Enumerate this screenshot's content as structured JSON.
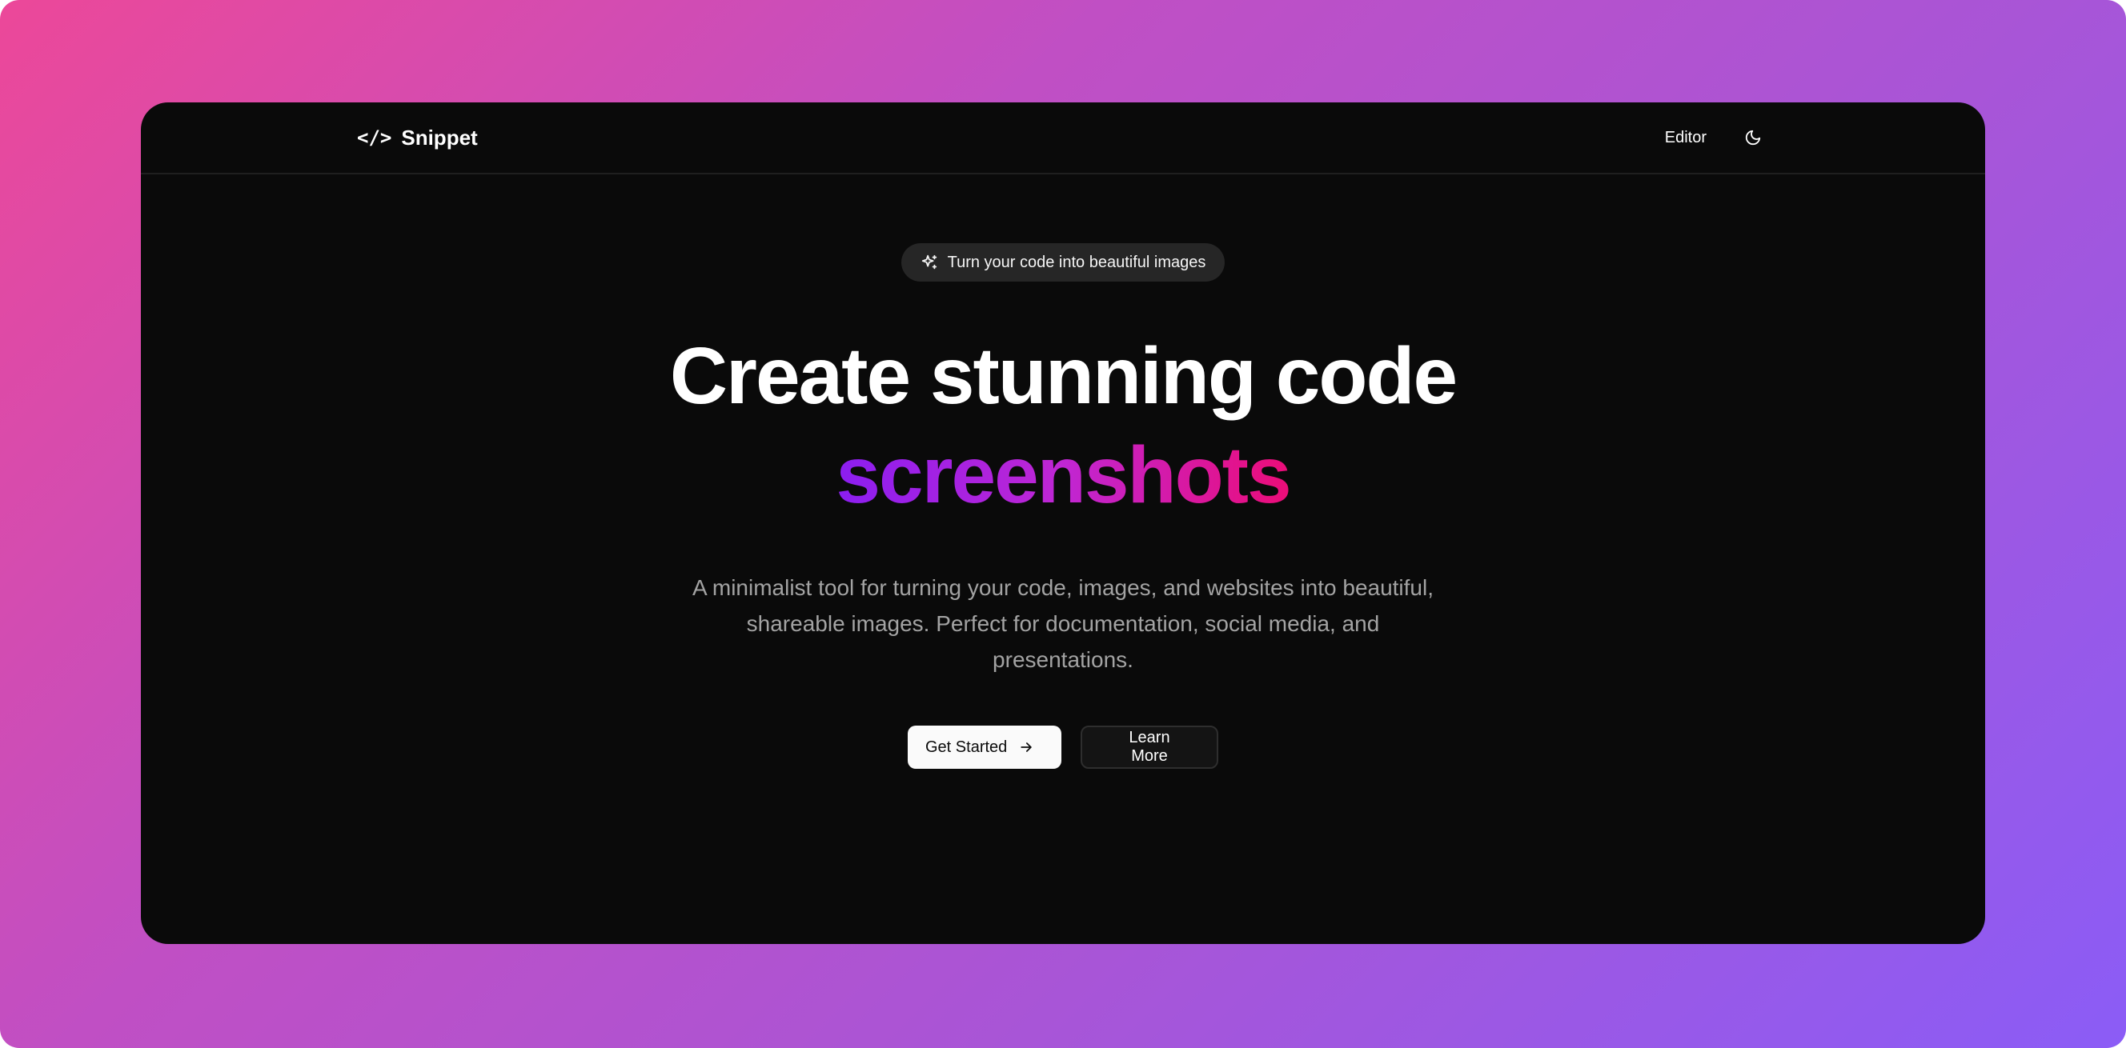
{
  "colors": {
    "background_gradient": [
      "#ec4899",
      "#a855d7",
      "#8b5cf6"
    ],
    "window_bg": "#0a0a0a",
    "headline_gradient": [
      "#8b1ef0",
      "#c026d3",
      "#ec0d78"
    ]
  },
  "navbar": {
    "logo_icon": "</>",
    "brand_name": "Snippet",
    "editor_link": "Editor",
    "theme_toggle_icon": "moon-icon"
  },
  "hero": {
    "badge_icon": "sparkles-icon",
    "badge_text": "Turn your code into beautiful images",
    "headline_line1": "Create stunning code",
    "headline_line2": "screenshots",
    "subtitle": "A minimalist tool for turning your code, images, and websites into beautiful, shareable images. Perfect for documentation, social media, and presentations.",
    "primary_button": "Get Started",
    "primary_button_icon": "arrow-right-icon",
    "secondary_button": "Learn More"
  }
}
